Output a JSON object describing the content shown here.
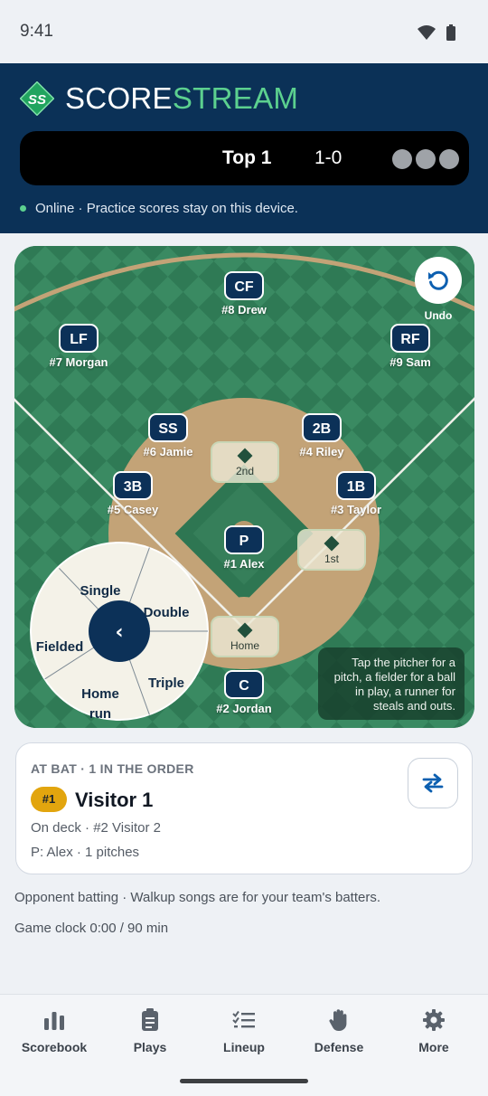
{
  "status_bar": {
    "time": "9:41"
  },
  "header": {
    "brand": {
      "logo_text": "SS",
      "name_part1": "SCORE",
      "name_part2": "STREAM"
    },
    "scoreboard": {
      "inning": "Top 1",
      "score": "1-0",
      "outs_total": 3
    },
    "connection": "Online · Practice scores stay on this device."
  },
  "field": {
    "undo_label": "Undo",
    "positions": {
      "cf": {
        "abbr": "CF",
        "player": "#8 Drew"
      },
      "lf": {
        "abbr": "LF",
        "player": "#7 Morgan"
      },
      "rf": {
        "abbr": "RF",
        "player": "#9 Sam"
      },
      "ss": {
        "abbr": "SS",
        "player": "#6 Jamie"
      },
      "second": {
        "abbr": "2B",
        "player": "#4 Riley"
      },
      "third": {
        "abbr": "3B",
        "player": "#5 Casey"
      },
      "first": {
        "abbr": "1B",
        "player": "#3 Taylor"
      },
      "pitcher": {
        "abbr": "P",
        "player": "#1 Alex"
      },
      "catcher": {
        "abbr": "C",
        "player": "#2 Jordan"
      }
    },
    "bases": {
      "second": "2nd",
      "first": "1st",
      "home": "Home"
    },
    "result_wheel": {
      "single": "Single",
      "double": "Double",
      "triple": "Triple",
      "home_run_line1": "Home",
      "home_run_line2": "run",
      "fielded": "Fielded",
      "center": "‹"
    },
    "hint": "Tap the pitcher for a pitch, a fielder for a ball in play, a runner for steals and outs."
  },
  "at_bat": {
    "caption": "AT BAT · 1 IN THE ORDER",
    "order_badge": "#1",
    "batter": "Visitor 1",
    "on_deck": "On deck · #2 Visitor 2",
    "pitcher_line": "P: Alex · 1 pitches"
  },
  "notes": {
    "opponent": "Opponent batting · Walkup songs are for your team's batters.",
    "game_clock": "Game clock  0:00 / 90 min"
  },
  "nav": [
    {
      "label": "Scorebook",
      "icon": "bar-chart-icon"
    },
    {
      "label": "Plays",
      "icon": "clipboard-icon"
    },
    {
      "label": "Lineup",
      "icon": "checklist-icon"
    },
    {
      "label": "Defense",
      "icon": "hand-icon"
    },
    {
      "label": "More",
      "icon": "gear-icon"
    }
  ],
  "colors": {
    "header_bg": "#0b3157",
    "brand_accent": "#5cd08f",
    "grass": "#2f7a55",
    "infield_dirt": "#c3a377",
    "badge_bg": "#0c3158",
    "order_badge": "#e2a50e"
  }
}
